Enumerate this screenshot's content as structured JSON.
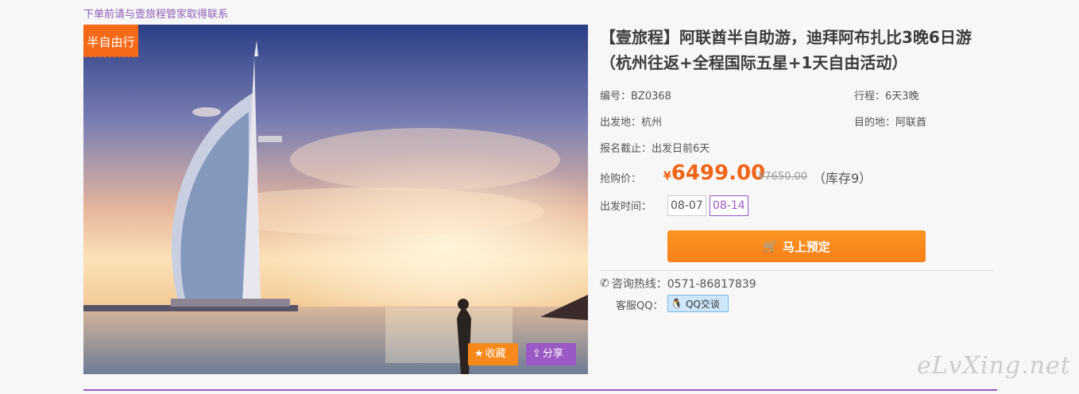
{
  "notice": "下单前请与壹旅程管家取得联系",
  "photo": {
    "tag": "半自由行",
    "fav_label": "收藏",
    "share_label": "分享"
  },
  "product": {
    "title": "【壹旅程】阿联酋半自助游，迪拜阿布扎比3晚6日游（杭州往返+全程国际五星+1天自由活动）",
    "code": "编号：BZ0368",
    "duration": "行程：6天3晚",
    "departure": "出发地：杭州",
    "destination": "目的地：阿联酋",
    "deadline": "报名截止：出发日前6天",
    "price_label": "抢购价：",
    "currency": "¥",
    "price": "6499.00",
    "old_price": "¥7650.00",
    "stock": "（库存9）",
    "date_label": "出发时间：",
    "dates": [
      "08-07",
      "08-14"
    ],
    "book_label": "马上预定",
    "hotline": "咨询热线：0571-86817839",
    "qq_label": "客服QQ：",
    "qq_button": "QQ交谈"
  },
  "watermark": "eLvXing.net",
  "colors": {
    "accent": "#f7891c",
    "purple": "#9b59c5",
    "price": "#f06515"
  }
}
